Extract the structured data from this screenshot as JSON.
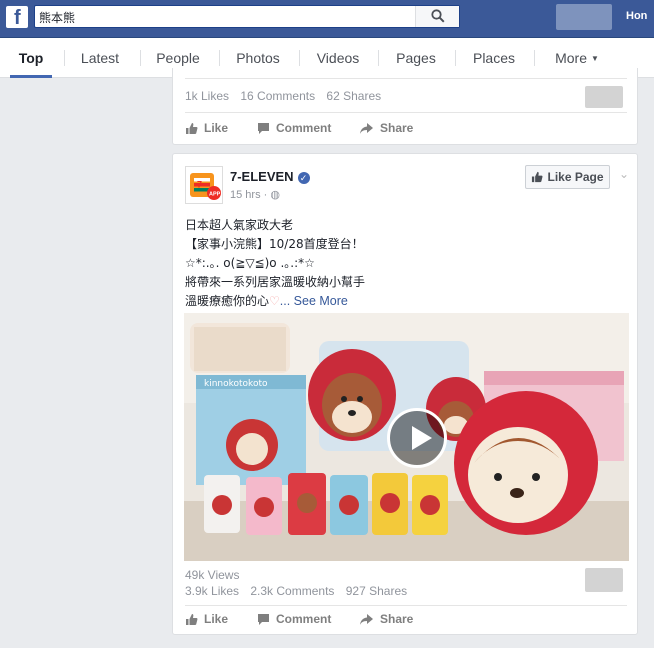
{
  "topbar": {
    "logo": "f",
    "search_value": "熊本熊",
    "search_icon": "search-icon",
    "home_label": "Hon"
  },
  "tabs": [
    {
      "label": "Top",
      "active": true
    },
    {
      "label": "Latest"
    },
    {
      "label": "People"
    },
    {
      "label": "Photos"
    },
    {
      "label": "Videos"
    },
    {
      "label": "Pages"
    },
    {
      "label": "Places"
    },
    {
      "label": "More"
    }
  ],
  "post1": {
    "likes": "1k Likes",
    "comments": "16 Comments",
    "shares": "62 Shares",
    "actions": {
      "like": "Like",
      "comment": "Comment",
      "share": "Share"
    }
  },
  "post2": {
    "page_name": "7-ELEVEN",
    "time": "15 hrs",
    "like_page": "Like Page",
    "text": {
      "line1": "日本超人氣家政大老",
      "line2": "【家事小浣熊】10/28首度登台！",
      "line3": "☆*:.｡. o(≧▽≦)o .｡.:*☆",
      "line4": "將帶來一系列居家溫暖收納小幫手",
      "line5": "溫暖療癒你的心",
      "heart": "♡",
      "see_more": "... See More"
    },
    "video_box_label": "kinnokotokoto",
    "views": "49k Views",
    "likes": "3.9k Likes",
    "comments": "2.3k Comments",
    "shares": "927 Shares",
    "actions": {
      "like": "Like",
      "comment": "Comment",
      "share": "Share"
    }
  },
  "colors": {
    "brand": "#3b5998",
    "link": "#365899",
    "meta": "#90949c"
  }
}
